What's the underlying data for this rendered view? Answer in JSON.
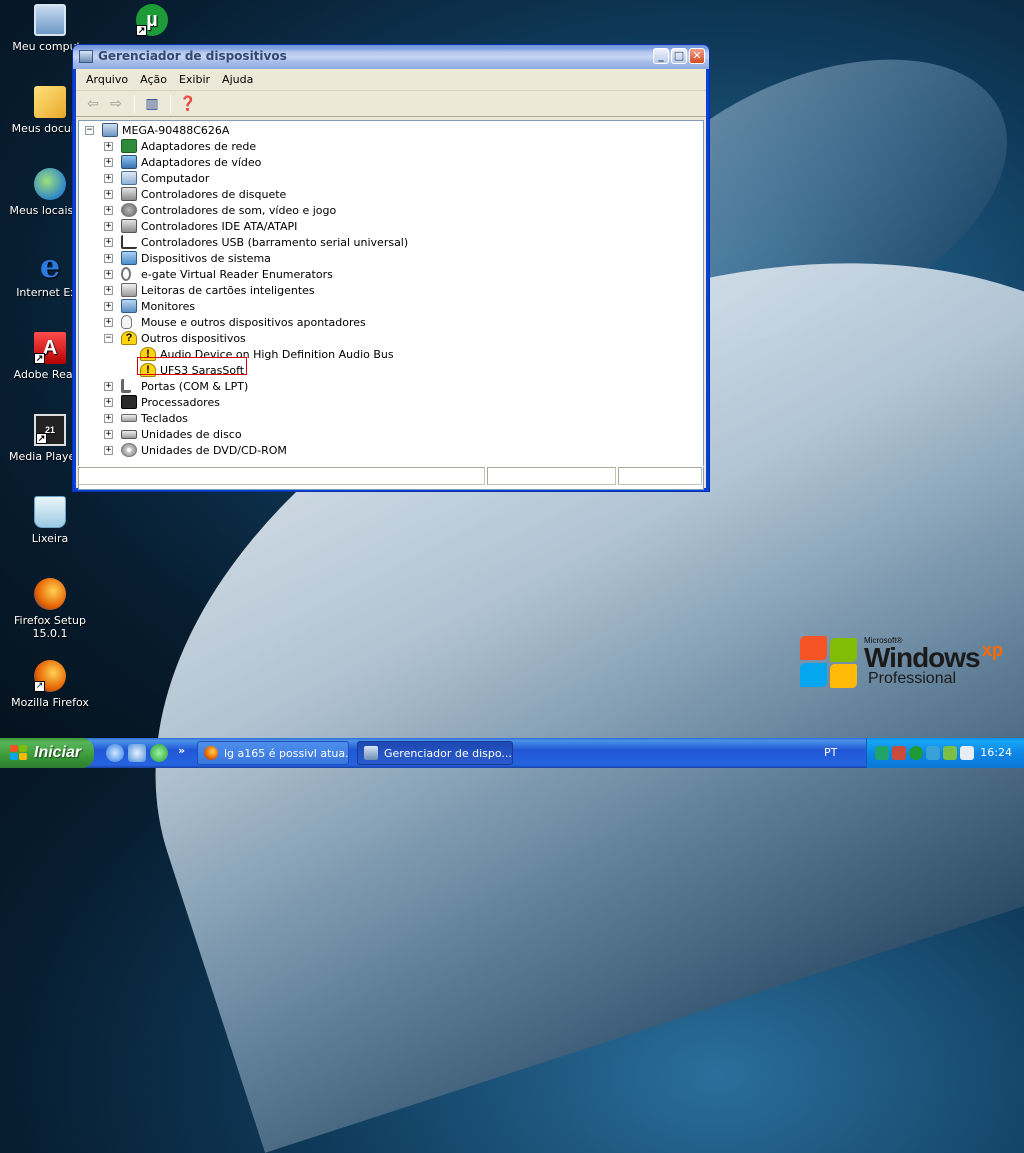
{
  "desktop": {
    "icons": [
      {
        "label": "Meu computa",
        "icon": "my-computer-icon"
      },
      {
        "label": "Meus docume",
        "icon": "my-documents-icon"
      },
      {
        "label": "Meus locais de",
        "icon": "network-places-icon"
      },
      {
        "label": "Internet Exp",
        "icon": "internet-explorer-icon"
      },
      {
        "label": "Adobe Reade",
        "icon": "adobe-reader-icon"
      },
      {
        "label": "Media Player C",
        "icon": "media-player-icon"
      },
      {
        "label": "Lixeira",
        "icon": "recycle-bin-icon"
      },
      {
        "label": "Firefox Setup\n15.0.1",
        "icon": "firefox-setup-icon"
      },
      {
        "label": "Mozilla Firefox",
        "icon": "firefox-icon"
      }
    ],
    "utorrent_icon": "utorrent-icon",
    "logo": {
      "microsoft": "Microsoft®",
      "windows": "Windows",
      "xp": "xp",
      "edition": "Professional"
    }
  },
  "window": {
    "title": "Gerenciador de dispositivos",
    "menu": [
      "Arquivo",
      "Ação",
      "Exibir",
      "Ajuda"
    ],
    "tree": {
      "root": "MEGA-90488C626A",
      "categories": [
        {
          "label": "Adaptadores de rede",
          "icon": "network-adapter-icon",
          "expanded": false
        },
        {
          "label": "Adaptadores de vídeo",
          "icon": "display-adapter-icon",
          "expanded": false
        },
        {
          "label": "Computador",
          "icon": "computer-icon",
          "expanded": false
        },
        {
          "label": "Controladores de disquete",
          "icon": "floppy-controller-icon",
          "expanded": false
        },
        {
          "label": "Controladores de som, vídeo e jogo",
          "icon": "sound-controller-icon",
          "expanded": false
        },
        {
          "label": "Controladores IDE ATA/ATAPI",
          "icon": "ide-controller-icon",
          "expanded": false
        },
        {
          "label": "Controladores USB (barramento serial universal)",
          "icon": "usb-icon",
          "expanded": false
        },
        {
          "label": "Dispositivos de sistema",
          "icon": "system-devices-icon",
          "expanded": false
        },
        {
          "label": "e-gate Virtual Reader Enumerators",
          "icon": "egate-icon",
          "expanded": false
        },
        {
          "label": "Leitoras de cartões inteligentes",
          "icon": "smart-card-icon",
          "expanded": false
        },
        {
          "label": "Monitores",
          "icon": "monitor-icon",
          "expanded": false
        },
        {
          "label": "Mouse e outros dispositivos apontadores",
          "icon": "mouse-icon",
          "expanded": false
        },
        {
          "label": "Outros dispositivos",
          "icon": "unknown-device-icon",
          "expanded": true
        },
        {
          "label": "Audio Device on High Definition Audio Bus",
          "icon": "warning-device-icon",
          "child": true
        },
        {
          "label": "UFS3 SarasSoft",
          "icon": "warning-device-icon",
          "child": true,
          "highlighted": true
        },
        {
          "label": "Portas (COM & LPT)",
          "icon": "ports-icon",
          "expanded": false
        },
        {
          "label": "Processadores",
          "icon": "processor-icon",
          "expanded": false
        },
        {
          "label": "Teclados",
          "icon": "keyboard-icon",
          "expanded": false
        },
        {
          "label": "Unidades de disco",
          "icon": "disk-drive-icon",
          "expanded": false
        },
        {
          "label": "Unidades de DVD/CD-ROM",
          "icon": "dvd-drive-icon",
          "expanded": false
        }
      ]
    }
  },
  "taskbar": {
    "start_label": "Iniciar",
    "quicklaunch_more": "»",
    "tasks": [
      {
        "label": "lg a165 é possivl atua...",
        "icon": "firefox-icon",
        "active": false
      },
      {
        "label": "Gerenciador de dispo...",
        "icon": "device-manager-icon",
        "active": true
      }
    ],
    "language": "PT",
    "clock": "16:24"
  },
  "colors": {
    "highlight": "#d40000",
    "titlebar": "#0a3fd8",
    "taskbar": "#245edb"
  }
}
